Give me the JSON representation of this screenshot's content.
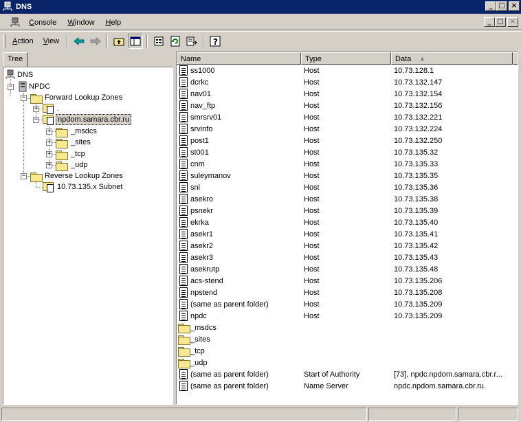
{
  "window": {
    "title": "DNS",
    "minimize": "_",
    "maximize": "□",
    "close": "×"
  },
  "menubar": {
    "items": [
      {
        "label": "Console",
        "access_key": "C",
        "rest": "onsole"
      },
      {
        "label": "Window",
        "access_key": "W",
        "rest": "indow"
      },
      {
        "label": "Help",
        "access_key": "H",
        "rest": "elp"
      }
    ]
  },
  "toolbar": {
    "action": {
      "access_key": "A",
      "rest": "ction"
    },
    "view": {
      "access_key": "V",
      "rest": "iew"
    },
    "icons": [
      "back-arrow-icon",
      "forward-arrow-icon",
      "up-folder-icon",
      "show-hide-tree-icon",
      "properties-icon",
      "refresh-icon",
      "export-list-icon",
      "help-icon"
    ]
  },
  "tree": {
    "tab_label": "Tree",
    "nodes": [
      {
        "label": "DNS",
        "icon": "dns-icon"
      },
      {
        "label": "NPDC",
        "icon": "server-icon",
        "expander": "−"
      },
      {
        "label": "Forward Lookup Zones",
        "icon": "folder-icon",
        "expander": "−"
      },
      {
        "label": ".",
        "icon": "zone-icon",
        "expander": "+"
      },
      {
        "label": "npdom.samara.cbr.ru",
        "icon": "zone-icon",
        "expander": "−",
        "selected": true
      },
      {
        "label": "_msdcs",
        "icon": "folder-icon",
        "expander": "+"
      },
      {
        "label": "_sites",
        "icon": "folder-icon",
        "expander": "+"
      },
      {
        "label": "_tcp",
        "icon": "folder-icon",
        "expander": "+"
      },
      {
        "label": "_udp",
        "icon": "folder-icon",
        "expander": "+"
      },
      {
        "label": "Reverse Lookup Zones",
        "icon": "folder-icon",
        "expander": "−"
      },
      {
        "label": "10.73.135.x Subnet",
        "icon": "zone-icon"
      }
    ]
  },
  "list": {
    "columns": [
      {
        "label": "Name"
      },
      {
        "label": "Type"
      },
      {
        "label": "Data",
        "sort": "▲"
      }
    ],
    "rows": [
      {
        "name": "ss1000",
        "type": "Host",
        "data": "10.73.128.1",
        "icon": "doc"
      },
      {
        "name": "dcrkc",
        "type": "Host",
        "data": "10.73.132.147",
        "icon": "doc"
      },
      {
        "name": "nav01",
        "type": "Host",
        "data": "10.73.132.154",
        "icon": "doc"
      },
      {
        "name": "nav_ftp",
        "type": "Host",
        "data": "10.73.132.156",
        "icon": "doc"
      },
      {
        "name": "smrsrv01",
        "type": "Host",
        "data": "10.73.132.221",
        "icon": "doc"
      },
      {
        "name": "srvinfo",
        "type": "Host",
        "data": "10.73.132.224",
        "icon": "doc"
      },
      {
        "name": "post1",
        "type": "Host",
        "data": "10.73.132.250",
        "icon": "doc"
      },
      {
        "name": "st001",
        "type": "Host",
        "data": "10.73.135.32",
        "icon": "doc"
      },
      {
        "name": "cnm",
        "type": "Host",
        "data": "10.73.135.33",
        "icon": "doc"
      },
      {
        "name": "suleymanov",
        "type": "Host",
        "data": "10.73.135.35",
        "icon": "doc"
      },
      {
        "name": "sni",
        "type": "Host",
        "data": "10.73.135.36",
        "icon": "doc"
      },
      {
        "name": "asekro",
        "type": "Host",
        "data": "10.73.135.38",
        "icon": "doc"
      },
      {
        "name": "psnekr",
        "type": "Host",
        "data": "10.73.135.39",
        "icon": "doc"
      },
      {
        "name": "ekrka",
        "type": "Host",
        "data": "10.73.135.40",
        "icon": "doc"
      },
      {
        "name": "asekr1",
        "type": "Host",
        "data": "10.73.135.41",
        "icon": "doc"
      },
      {
        "name": "asekr2",
        "type": "Host",
        "data": "10.73.135.42",
        "icon": "doc"
      },
      {
        "name": "asekr3",
        "type": "Host",
        "data": "10.73.135.43",
        "icon": "doc"
      },
      {
        "name": "asekrutp",
        "type": "Host",
        "data": "10.73.135.48",
        "icon": "doc"
      },
      {
        "name": "acs-stend",
        "type": "Host",
        "data": "10.73.135.206",
        "icon": "doc"
      },
      {
        "name": "npstend",
        "type": "Host",
        "data": "10.73.135.208",
        "icon": "doc"
      },
      {
        "name": "(same as parent folder)",
        "type": "Host",
        "data": "10.73.135.209",
        "icon": "doc"
      },
      {
        "name": "npdc",
        "type": "Host",
        "data": "10.73.135.209",
        "icon": "doc"
      },
      {
        "name": "_msdcs",
        "type": "",
        "data": "",
        "icon": "folder"
      },
      {
        "name": "_sites",
        "type": "",
        "data": "",
        "icon": "folder"
      },
      {
        "name": "_tcp",
        "type": "",
        "data": "",
        "icon": "folder"
      },
      {
        "name": "_udp",
        "type": "",
        "data": "",
        "icon": "folder"
      },
      {
        "name": "(same as parent folder)",
        "type": "Start of Authority",
        "data": "[73], npdc.npdom.samara.cbr.r...",
        "icon": "doc"
      },
      {
        "name": "(same as parent folder)",
        "type": "Name Server",
        "data": "npdc.npdom.samara.cbr.ru.",
        "icon": "doc"
      }
    ]
  }
}
